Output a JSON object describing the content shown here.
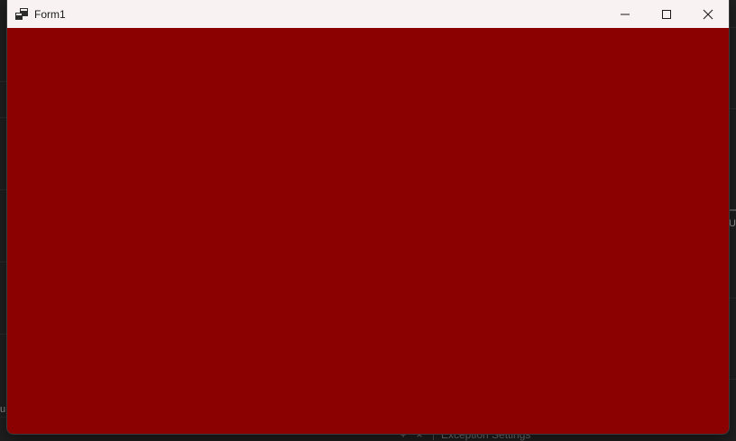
{
  "window": {
    "title": "Form1",
    "client_color": "#8b0000",
    "titlebar_color": "#f8f3f2"
  },
  "caption_buttons": {
    "minimize_icon": "minimize-icon",
    "maximize_icon": "maximize-icon",
    "close_icon": "close-icon"
  },
  "background": {
    "right_fragment": "U I",
    "left_fragment": "u",
    "bottom_icons": [
      "+",
      "×"
    ],
    "bottom_label": "Exception Settings"
  }
}
